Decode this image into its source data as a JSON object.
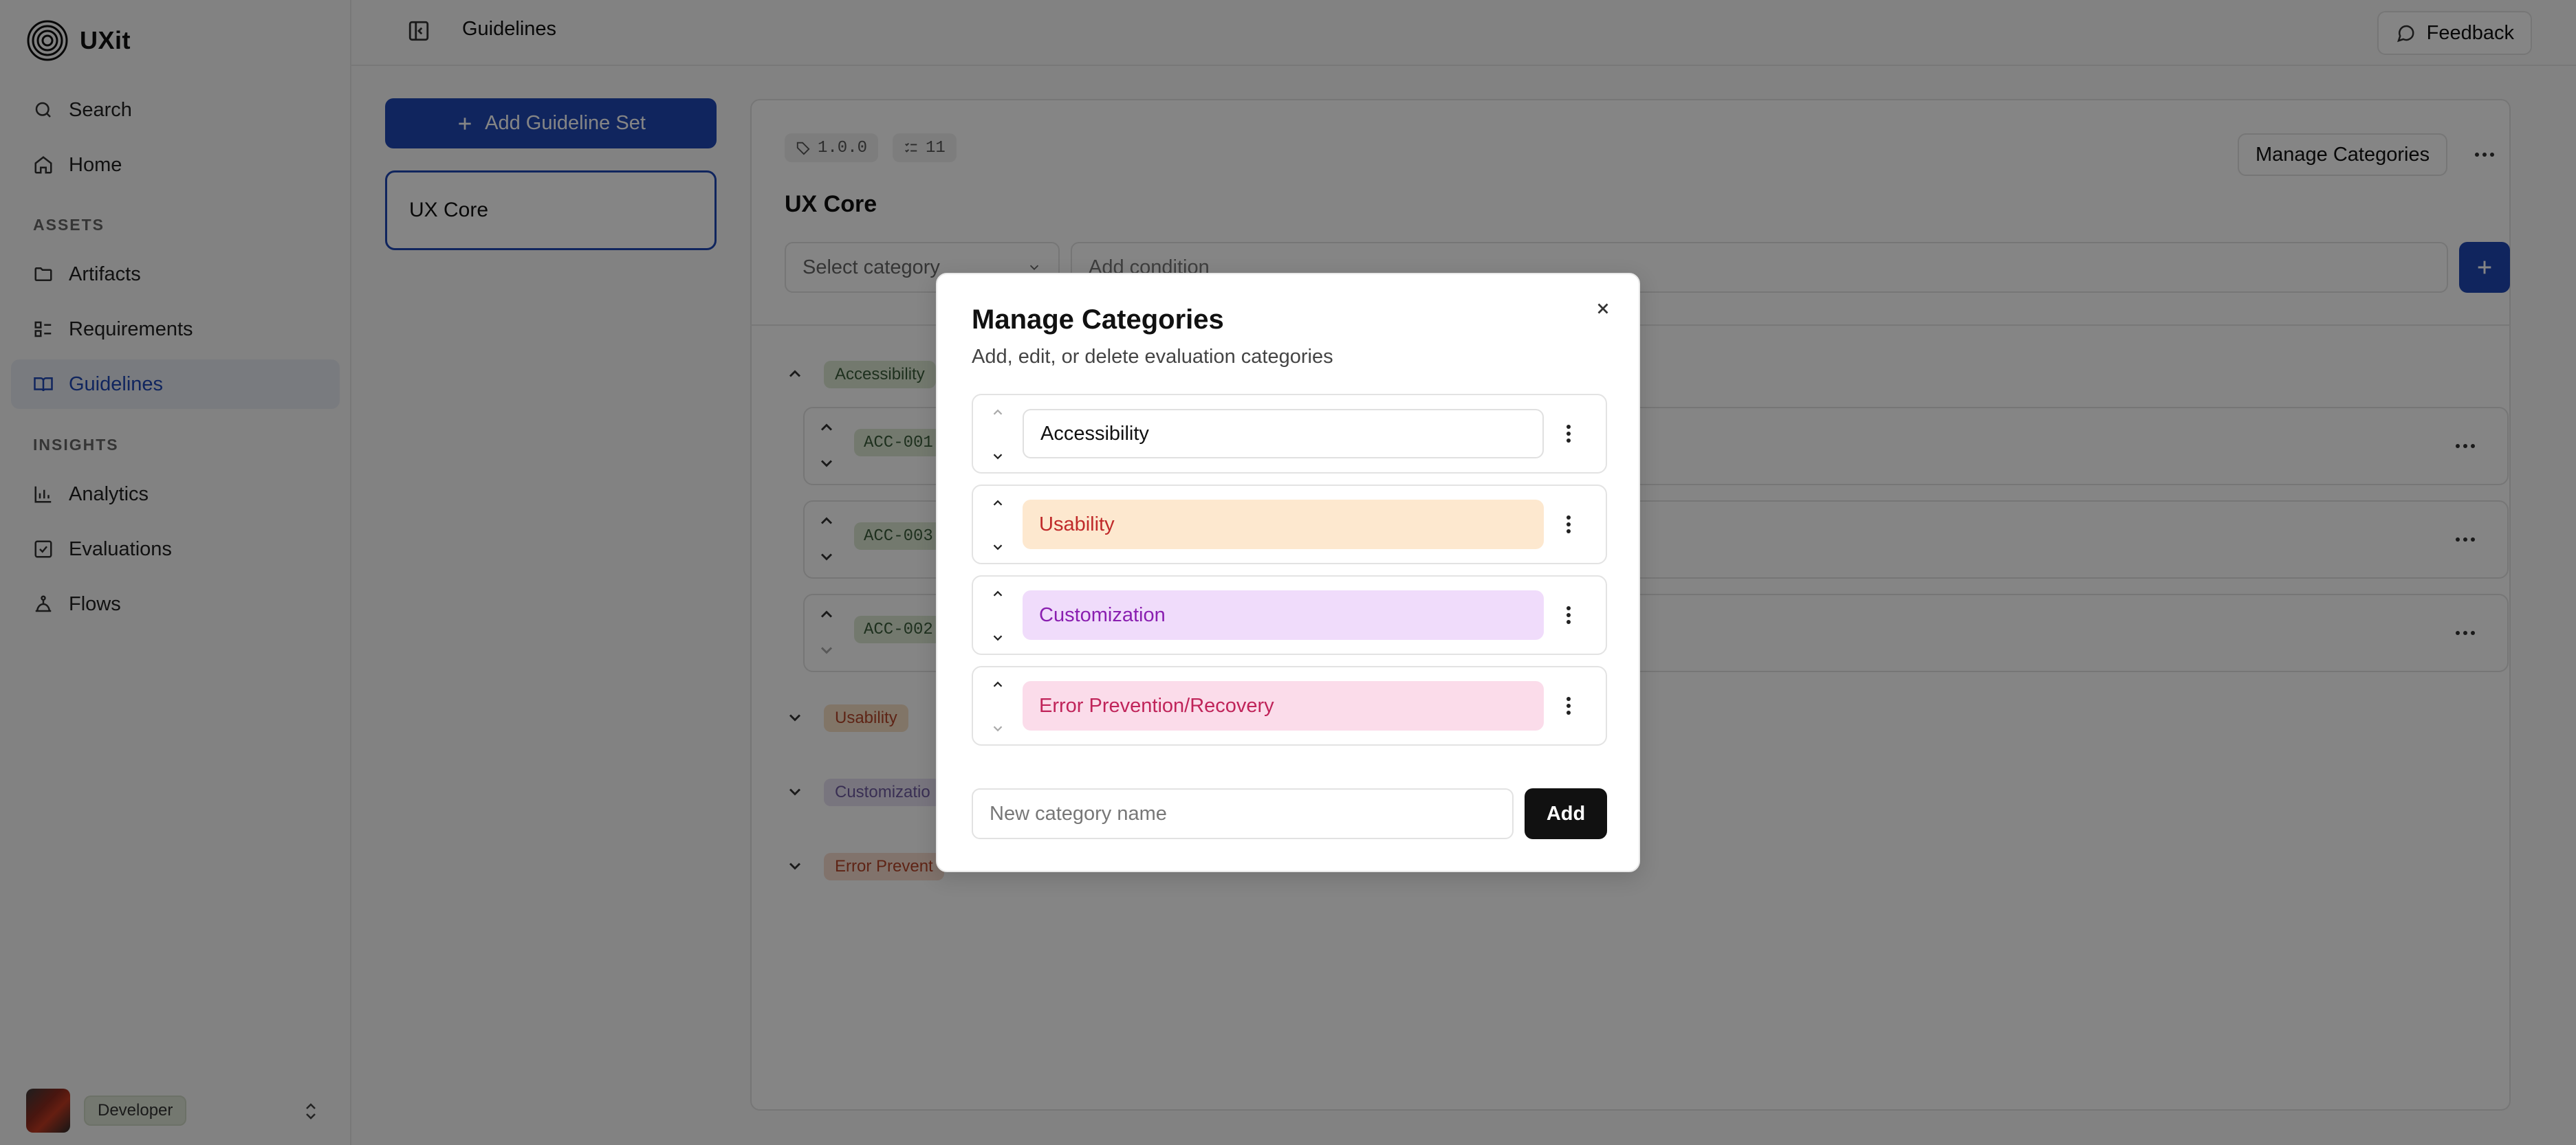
{
  "app": {
    "name": "UXit"
  },
  "sidebar": {
    "items": [
      {
        "label": "Search",
        "icon": "search-icon"
      },
      {
        "label": "Home",
        "icon": "home-icon"
      }
    ],
    "assets_label": "ASSETS",
    "assets": [
      {
        "label": "Artifacts",
        "icon": "folder-icon"
      },
      {
        "label": "Requirements",
        "icon": "list-icon"
      },
      {
        "label": "Guidelines",
        "icon": "book-icon",
        "active": true
      }
    ],
    "insights_label": "INSIGHTS",
    "insights": [
      {
        "label": "Analytics",
        "icon": "chart-icon"
      },
      {
        "label": "Evaluations",
        "icon": "checkbox-icon"
      },
      {
        "label": "Flows",
        "icon": "flow-icon"
      }
    ],
    "user": {
      "role": "Developer"
    }
  },
  "header": {
    "title": "Guidelines",
    "feedback_label": "Feedback"
  },
  "guideline_sets": {
    "add_label": "Add Guideline Set",
    "items": [
      {
        "name": "UX Core"
      }
    ]
  },
  "detail": {
    "version": "1.0.0",
    "count": "11",
    "title": "UX Core",
    "manage_categories_label": "Manage Categories",
    "select_category_placeholder": "Select category",
    "add_condition_placeholder": "Add condition",
    "groups": [
      {
        "name": "Accessibility",
        "color": "#dde9d4",
        "text_color": "#3a5c3a"
      },
      {
        "name": "Usability",
        "color": "#f7e0c6",
        "text_color": "#b5452a"
      },
      {
        "name": "Customizatio",
        "color": "#e7e0f2",
        "text_color": "#6e5aa0"
      },
      {
        "name": "Error Prevent",
        "color": "#f8dcd0",
        "text_color": "#b5452a"
      }
    ],
    "rows": [
      {
        "code": "ACC-001"
      },
      {
        "code": "ACC-003"
      },
      {
        "code": "ACC-002"
      }
    ]
  },
  "modal": {
    "title": "Manage Categories",
    "subtitle": "Add, edit, or delete evaluation categories",
    "categories": [
      {
        "name": "Accessibility",
        "bg": "#ffffff",
        "fg": "#111111",
        "editing": true
      },
      {
        "name": "Usability",
        "bg": "#fde8cf",
        "fg": "#c02a2a"
      },
      {
        "name": "Customization",
        "bg": "#f0dcfb",
        "fg": "#8a1fb0"
      },
      {
        "name": "Error Prevention/Recovery",
        "bg": "#fbdcea",
        "fg": "#c0245a"
      }
    ],
    "new_placeholder": "New category name",
    "add_label": "Add"
  },
  "colors": {
    "accent": "#1f47b5",
    "background": "#fafafa"
  }
}
